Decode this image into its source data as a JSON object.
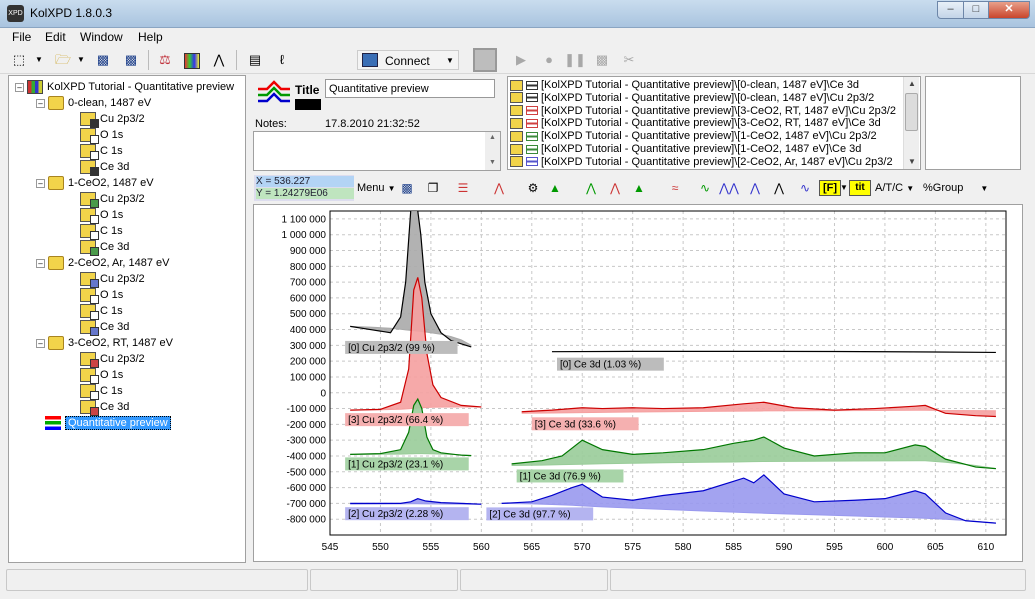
{
  "window": {
    "title": "KolXPD 1.8.0.3",
    "app_icon_text": "XPD"
  },
  "menu": [
    "File",
    "Edit",
    "Window",
    "Help"
  ],
  "toolbar": {
    "connect_label": "Connect"
  },
  "tree": {
    "root": "KolXPD Tutorial - Quantitative preview",
    "groups": [
      {
        "label": "0-clean, 1487 eV",
        "items": [
          "Cu 2p3/2",
          "O 1s",
          "C 1s",
          "Ce 3d"
        ]
      },
      {
        "label": "1-CeO2, 1487 eV",
        "items": [
          "Cu 2p3/2",
          "O 1s",
          "C 1s",
          "Ce 3d"
        ]
      },
      {
        "label": "2-CeO2, Ar, 1487 eV",
        "items": [
          "Cu 2p3/2",
          "O 1s",
          "C 1s",
          "Ce 3d"
        ]
      },
      {
        "label": "3-CeO2, RT, 1487 eV",
        "items": [
          "Cu 2p3/2",
          "O 1s",
          "C 1s",
          "Ce 3d"
        ]
      }
    ],
    "selected": "Quantitative preview"
  },
  "header": {
    "title_label": "Title",
    "title_value": "Quantitative preview",
    "notes_label": "Notes:",
    "notes_date": "17.8.2010 21:32:52"
  },
  "spectra_list": [
    {
      "text": "[KolXPD Tutorial - Quantitative preview]\\[0-clean, 1487 eV]\\Ce 3d",
      "color": "#333333"
    },
    {
      "text": "[KolXPD Tutorial - Quantitative preview]\\[0-clean, 1487 eV]\\Cu 2p3/2",
      "color": "#333333"
    },
    {
      "text": "[KolXPD Tutorial - Quantitative preview]\\[3-CeO2, RT, 1487 eV]\\Cu 2p3/2",
      "color": "#d04040"
    },
    {
      "text": "[KolXPD Tutorial - Quantitative preview]\\[3-CeO2, RT, 1487 eV]\\Ce 3d",
      "color": "#d04040"
    },
    {
      "text": "[KolXPD Tutorial - Quantitative preview]\\[1-CeO2, 1487 eV]\\Cu 2p3/2",
      "color": "#3a8a3a"
    },
    {
      "text": "[KolXPD Tutorial - Quantitative preview]\\[1-CeO2, 1487 eV]\\Ce 3d",
      "color": "#3a8a3a"
    },
    {
      "text": "[KolXPD Tutorial - Quantitative preview]\\[2-CeO2, Ar, 1487 eV]\\Cu 2p3/2",
      "color": "#5555cc"
    }
  ],
  "chart_toolbar": {
    "x_readout": "X = 536.227",
    "y_readout": "Y = 1.24279E06",
    "menu_label": "Menu",
    "f_label": "[F]",
    "tit_label": "tit",
    "atc_label": "A/T/C",
    "group_label": "%Group"
  },
  "chart_data": {
    "type": "line",
    "xlim": [
      545,
      612
    ],
    "ylim": [
      -900000,
      1150000
    ],
    "x_ticks": [
      545,
      550,
      555,
      560,
      565,
      570,
      575,
      580,
      585,
      590,
      595,
      600,
      605,
      610
    ],
    "y_ticks": [
      -800000,
      -700000,
      -600000,
      -500000,
      -400000,
      -300000,
      -200000,
      -100000,
      0,
      100000,
      200000,
      300000,
      400000,
      500000,
      600000,
      700000,
      800000,
      900000,
      1000000,
      1100000
    ],
    "y_tick_labels": [
      "-800 000",
      "-700 000",
      "-600 000",
      "-500 000",
      "-400 000",
      "-300 000",
      "-200 000",
      "-100 000",
      "0",
      "100 000",
      "200 000",
      "300 000",
      "400 000",
      "500 000",
      "600 000",
      "700 000",
      "800 000",
      "900 000",
      "1 000 000",
      "1 100 000"
    ],
    "grid": true,
    "series": [
      {
        "group": 0,
        "color": "#000000",
        "fill": "#aaaaaa",
        "cu": {
          "label": "[0] Cu 2p3/2 (99 %)",
          "x": [
            547,
            549,
            551,
            552,
            552.5,
            553,
            553.3,
            553.6,
            554,
            554.4,
            555,
            556,
            557,
            558,
            559
          ],
          "y": [
            420000,
            400000,
            380000,
            480000,
            700000,
            1150000,
            1250000,
            1200000,
            1000000,
            700000,
            500000,
            380000,
            330000,
            310000,
            290000
          ],
          "base": [
            420000,
            415000,
            408000,
            402000,
            398000,
            395000,
            393000,
            391000,
            388000,
            385000,
            380000,
            370000,
            355000,
            335000,
            300000
          ]
        },
        "ce": {
          "label": "[0] Ce 3d (1.03 %)",
          "x": [
            567,
            575,
            585,
            595,
            605,
            611
          ],
          "y": [
            260000,
            262000,
            262000,
            261000,
            258000,
            255000
          ]
        }
      },
      {
        "group": 3,
        "color": "#cc0000",
        "fill": "#f5a0a0",
        "cu": {
          "label": "[3] Cu 2p3/2 (66.4 %)",
          "x": [
            547,
            550,
            552,
            552.8,
            553.3,
            553.7,
            554.1,
            554.6,
            555.2,
            556,
            558,
            560
          ],
          "y": [
            -110000,
            -105000,
            -60000,
            150000,
            650000,
            730000,
            600000,
            250000,
            50000,
            -30000,
            -80000,
            -90000
          ],
          "base": [
            -110000,
            -108000,
            -104000,
            -101000,
            -99000,
            -97000,
            -95000,
            -93000,
            -92000,
            -91000,
            -90000,
            -90000
          ]
        },
        "ce": {
          "label": "[3] Ce 3d (33.6 %)",
          "x": [
            564,
            567,
            570,
            572,
            575,
            578,
            582,
            586,
            588,
            591,
            595,
            599,
            603,
            604,
            606,
            609,
            611
          ],
          "y": [
            -120000,
            -110000,
            -95000,
            -100000,
            -95000,
            -100000,
            -95000,
            -70000,
            -60000,
            -95000,
            -110000,
            -100000,
            -85000,
            -80000,
            -130000,
            -145000,
            -150000
          ],
          "base": [
            -130000,
            -128000,
            -126000,
            -124000,
            -122000,
            -120000,
            -118000,
            -116000,
            -115000,
            -114000,
            -113000,
            -112000,
            -111000,
            -111000,
            -112000,
            -113000,
            -114000
          ]
        }
      },
      {
        "group": 1,
        "color": "#007700",
        "fill": "#99cc99",
        "cu": {
          "label": "[1] Cu 2p3/2 (23.1 %)",
          "x": [
            547,
            550,
            552,
            552.8,
            553.3,
            553.7,
            554.1,
            554.6,
            555.2,
            556,
            558,
            559
          ],
          "y": [
            -390000,
            -385000,
            -360000,
            -250000,
            -80000,
            -40000,
            -100000,
            -280000,
            -360000,
            -380000,
            -395000,
            -398000
          ],
          "base": [
            -390000,
            -389000,
            -388000,
            -387000,
            -386000,
            -385000,
            -385000,
            -386000,
            -387000,
            -388000,
            -392000,
            -396000
          ]
        },
        "ce": {
          "label": "[1] Ce 3d (76.9 %)",
          "x": [
            563,
            566,
            568,
            570,
            572,
            575,
            578,
            582,
            585,
            587,
            588,
            590,
            593,
            597,
            600,
            603,
            604,
            606,
            609,
            611
          ],
          "y": [
            -450000,
            -430000,
            -400000,
            -300000,
            -360000,
            -390000,
            -380000,
            -360000,
            -320000,
            -300000,
            -280000,
            -350000,
            -400000,
            -380000,
            -380000,
            -330000,
            -340000,
            -420000,
            -470000,
            -480000
          ],
          "base": [
            -460000,
            -458000,
            -455000,
            -452000,
            -449000,
            -446000,
            -443000,
            -440000,
            -438000,
            -436000,
            -435000,
            -434000,
            -433000,
            -432000,
            -431000,
            -430000,
            -430000,
            -440000,
            -460000,
            -480000
          ]
        }
      },
      {
        "group": 2,
        "color": "#0000cc",
        "fill": "#9999ee",
        "cu": {
          "label": "[2] Cu 2p3/2 (2.28 %)",
          "x": [
            547,
            550,
            552,
            553,
            553.7,
            554.5,
            556,
            558,
            560
          ],
          "y": [
            -700000,
            -700000,
            -700000,
            -690000,
            -670000,
            -685000,
            -695000,
            -700000,
            -705000
          ],
          "base": [
            -705000,
            -704000,
            -703000,
            -702000,
            -702000,
            -703000,
            -704000,
            -705000,
            -706000
          ]
        },
        "ce": {
          "label": "[2] Ce 3d (97.7 %)",
          "x": [
            562,
            565,
            567,
            569,
            570,
            572,
            575,
            578,
            582,
            585,
            586,
            587,
            588,
            590,
            593,
            597,
            600,
            603,
            604,
            606,
            608,
            611
          ],
          "y": [
            -700000,
            -690000,
            -650000,
            -600000,
            -580000,
            -660000,
            -680000,
            -650000,
            -620000,
            -560000,
            -540000,
            -570000,
            -520000,
            -640000,
            -690000,
            -680000,
            -670000,
            -620000,
            -640000,
            -760000,
            -810000,
            -825000
          ],
          "base": [
            -700000,
            -703000,
            -707000,
            -712000,
            -716000,
            -722000,
            -730000,
            -738000,
            -748000,
            -755000,
            -758000,
            -760000,
            -762000,
            -766000,
            -772000,
            -780000,
            -786000,
            -792000,
            -794000,
            -800000,
            -808000,
            -825000
          ]
        }
      }
    ]
  }
}
